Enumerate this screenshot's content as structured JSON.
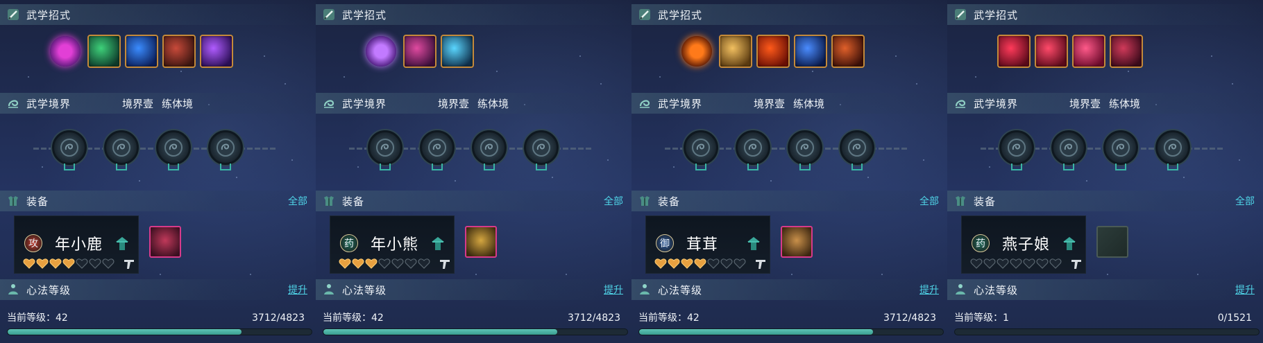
{
  "panels": [
    {
      "skills_header": "武学招式",
      "realm_header": "武学境界",
      "realm_level": "境界壹",
      "realm_name": "练体境",
      "equip_header": "装备",
      "equip_all": "全部",
      "character": {
        "name": "年小鹿",
        "role_glyph": "攻",
        "role_color": "#c0392b",
        "hearts_filled": 4,
        "hearts_total": 7
      },
      "equip_item_empty": false,
      "mind_header": "心法等级",
      "mind_action": "提升",
      "level_label": "当前等级：42",
      "exp_text": "3712/4823",
      "progress": 0.77,
      "skills": [
        {
          "icon": "purple-orb-skill-icon",
          "main": true,
          "c1": "#e23fd6",
          "c2": "#5a1a7a"
        },
        {
          "icon": "green-burst-skill-icon",
          "c1": "#3ed17a",
          "c2": "#0e3a2a"
        },
        {
          "icon": "blue-dragon-skill-icon",
          "c1": "#3a8cff",
          "c2": "#0c1f5a"
        },
        {
          "icon": "red-beast-skill-icon",
          "c1": "#c84a3a",
          "c2": "#3a1510"
        },
        {
          "icon": "purple-spirit-skill-icon",
          "c1": "#b05cff",
          "c2": "#2a0f55"
        }
      ],
      "equip_item": {
        "c1": "#c0395a",
        "c2": "#3a0f20"
      }
    },
    {
      "skills_header": "武学招式",
      "realm_header": "武学境界",
      "realm_level": "境界壹",
      "realm_name": "练体境",
      "equip_header": "装备",
      "equip_all": "全部",
      "character": {
        "name": "年小熊",
        "role_glyph": "药",
        "role_color": "#1e6b5a",
        "hearts_filled": 3,
        "hearts_total": 7
      },
      "equip_item_empty": false,
      "mind_header": "心法等级",
      "mind_action": "提升",
      "level_label": "当前等级：42",
      "exp_text": "3712/4823",
      "progress": 0.77,
      "skills": [
        {
          "icon": "purple-cone-skill-icon",
          "main": true,
          "c1": "#c27aff",
          "c2": "#4a1a7a"
        },
        {
          "icon": "pink-crane-skill-icon",
          "c1": "#e04aa0",
          "c2": "#3a0f3a"
        },
        {
          "icon": "cyan-wave-skill-icon",
          "c1": "#5ad6ff",
          "c2": "#0f2f4a"
        }
      ],
      "equip_item": {
        "c1": "#d4a640",
        "c2": "#3a2a0f"
      }
    },
    {
      "skills_header": "武学招式",
      "realm_header": "武学境界",
      "realm_level": "境界壹",
      "realm_name": "练体境",
      "equip_header": "装备",
      "equip_all": "全部",
      "character": {
        "name": "茸茸",
        "role_glyph": "御",
        "role_color": "#2a5aa0",
        "hearts_filled": 4,
        "hearts_total": 7
      },
      "equip_item_empty": false,
      "mind_header": "心法等级",
      "mind_action": "提升",
      "level_label": "当前等级：42",
      "exp_text": "3712/4823",
      "progress": 0.77,
      "skills": [
        {
          "icon": "fire-figure-skill-icon",
          "main": true,
          "c1": "#ff7a1a",
          "c2": "#5a1a05"
        },
        {
          "icon": "golden-buddha-skill-icon",
          "c1": "#f2c060",
          "c2": "#5a3a10"
        },
        {
          "icon": "fire-blast-skill-icon",
          "c1": "#ff5a1a",
          "c2": "#6a0f05"
        },
        {
          "icon": "blue-crescent-skill-icon",
          "c1": "#4a8cff",
          "c2": "#0a1a4a"
        },
        {
          "icon": "flame-vortex-skill-icon",
          "c1": "#e0602a",
          "c2": "#3a0f08"
        }
      ],
      "equip_item": {
        "c1": "#c9904a",
        "c2": "#3a2510"
      }
    },
    {
      "skills_header": "武学招式",
      "realm_header": "武学境界",
      "realm_level": "境界壹",
      "realm_name": "练体境",
      "equip_header": "装备",
      "equip_all": "全部",
      "character": {
        "name": "燕子娘",
        "role_glyph": "药",
        "role_color": "#1e6b5a",
        "hearts_filled": 0,
        "hearts_total": 7
      },
      "equip_item_empty": true,
      "mind_header": "心法等级",
      "mind_action": "提升",
      "level_label": "当前等级：1",
      "exp_text": "0/1521",
      "progress": 0.0,
      "skills": [
        {
          "icon": "red-slash-skill-icon",
          "c1": "#ff3a5a",
          "c2": "#5a0a1a"
        },
        {
          "icon": "red-slash-2-skill-icon",
          "c1": "#ff4a6a",
          "c2": "#5a0a1a"
        },
        {
          "icon": "pink-rose-skill-icon",
          "c1": "#ff5a8a",
          "c2": "#6a0a2a"
        },
        {
          "icon": "crimson-figure-skill-icon",
          "c1": "#d03a5a",
          "c2": "#3a0a1a"
        }
      ],
      "equip_item": {
        "c1": "#3a5048",
        "c2": "#1e2a28"
      }
    }
  ]
}
